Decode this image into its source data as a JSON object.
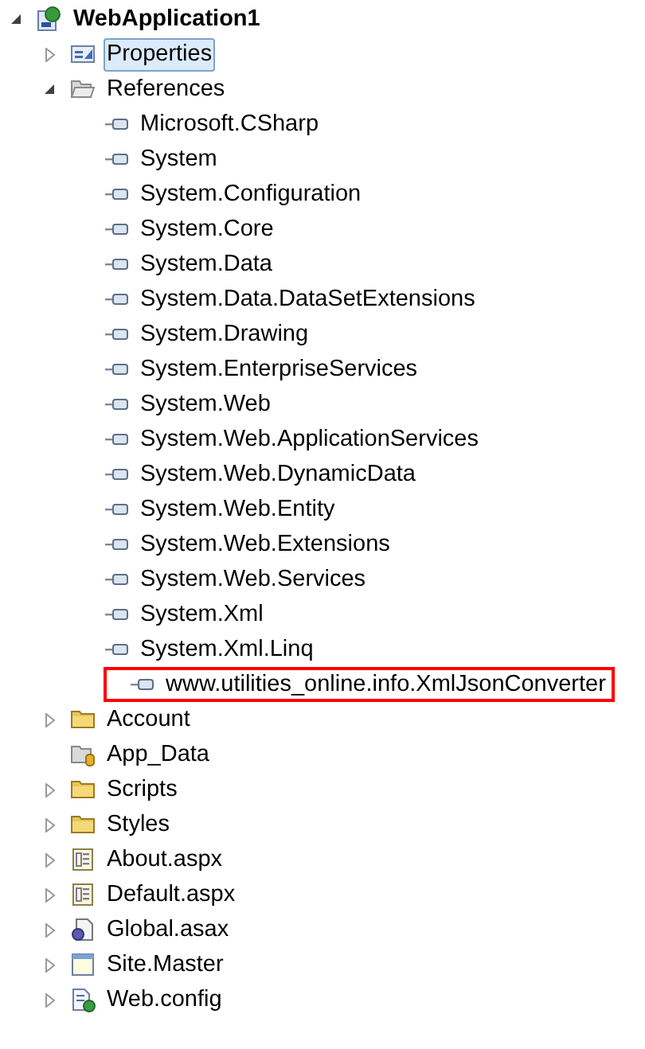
{
  "tree": [
    {
      "label": "WebApplication1",
      "kind": "project",
      "expanded": true,
      "selected": false,
      "children": [
        {
          "label": "Properties",
          "kind": "properties",
          "expanded": false,
          "selected": true
        },
        {
          "label": "References",
          "kind": "references",
          "expanded": true,
          "selected": false,
          "children": [
            {
              "label": "Microsoft.CSharp",
              "kind": "reference",
              "selected": false
            },
            {
              "label": "System",
              "kind": "reference",
              "selected": false
            },
            {
              "label": "System.Configuration",
              "kind": "reference",
              "selected": false
            },
            {
              "label": "System.Core",
              "kind": "reference",
              "selected": false
            },
            {
              "label": "System.Data",
              "kind": "reference",
              "selected": false
            },
            {
              "label": "System.Data.DataSetExtensions",
              "kind": "reference",
              "selected": false
            },
            {
              "label": "System.Drawing",
              "kind": "reference",
              "selected": false
            },
            {
              "label": "System.EnterpriseServices",
              "kind": "reference",
              "selected": false
            },
            {
              "label": "System.Web",
              "kind": "reference",
              "selected": false
            },
            {
              "label": "System.Web.ApplicationServices",
              "kind": "reference",
              "selected": false
            },
            {
              "label": "System.Web.DynamicData",
              "kind": "reference",
              "selected": false
            },
            {
              "label": "System.Web.Entity",
              "kind": "reference",
              "selected": false
            },
            {
              "label": "System.Web.Extensions",
              "kind": "reference",
              "selected": false
            },
            {
              "label": "System.Web.Services",
              "kind": "reference",
              "selected": false
            },
            {
              "label": "System.Xml",
              "kind": "reference",
              "selected": false
            },
            {
              "label": "System.Xml.Linq",
              "kind": "reference",
              "selected": false
            },
            {
              "label": "www.utilities_online.info.XmlJsonConverter",
              "kind": "reference",
              "selected": false,
              "highlighted": true
            }
          ]
        },
        {
          "label": "Account",
          "kind": "folder",
          "expanded": false,
          "selected": false
        },
        {
          "label": "App_Data",
          "kind": "data-folder",
          "selected": false
        },
        {
          "label": "Scripts",
          "kind": "folder",
          "expanded": false,
          "selected": false
        },
        {
          "label": "Styles",
          "kind": "folder",
          "expanded": false,
          "selected": false
        },
        {
          "label": "About.aspx",
          "kind": "page",
          "expanded": false,
          "selected": false
        },
        {
          "label": "Default.aspx",
          "kind": "page",
          "expanded": false,
          "selected": false
        },
        {
          "label": "Global.asax",
          "kind": "global",
          "expanded": false,
          "selected": false
        },
        {
          "label": "Site.Master",
          "kind": "master",
          "expanded": false,
          "selected": false
        },
        {
          "label": "Web.config",
          "kind": "config",
          "expanded": false,
          "selected": false
        }
      ]
    }
  ]
}
